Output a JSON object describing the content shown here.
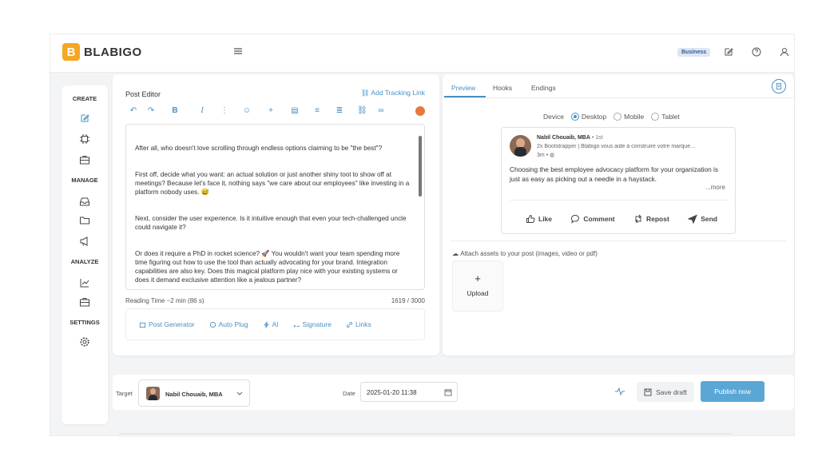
{
  "app": {
    "logo_letter": "B",
    "name": "BLABIGO",
    "plan_badge": "Business"
  },
  "sidebar": {
    "sections": [
      {
        "label": "CREATE",
        "icons": [
          "edit-icon",
          "chip-icon",
          "briefcase-icon"
        ]
      },
      {
        "label": "MANAGE",
        "icons": [
          "inbox-icon",
          "folder-icon",
          "megaphone-icon"
        ]
      },
      {
        "label": "ANALYZE",
        "icons": [
          "chart-icon",
          "briefcase-icon"
        ]
      },
      {
        "label": "SETTINGS",
        "icons": [
          "gear-icon"
        ]
      }
    ]
  },
  "editor": {
    "title": "Post Editor",
    "tracking_link": "Add Tracking Link",
    "paragraphs": [
      "After all, who doesn't love scrolling through endless options claiming to be \"the best\"?",
      "First off, decide what you want: an actual solution or just another shiny tool to show off at meetings? Because let's face it, nothing says \"we care about our employees\" like investing in a platform nobody uses. 😅",
      "Next, consider the user experience. Is it intuitive enough that even your tech-challenged uncle could navigate it?",
      "Or does it require a PhD in rocket science? 🚀 You wouldn't want your team spending more time figuring out how to use the tool than actually advocating for your brand. Integration capabilities are also key. Does this magical platform play nice with your existing systems or does it demand exclusive attention like a jealous partner?"
    ],
    "reading_time": "Reading Time ~2 min (86 s)",
    "char_count": "1619 / 3000",
    "tools": [
      "Post Generator",
      "Auto Plug",
      "AI",
      "Signature",
      "Links"
    ]
  },
  "preview": {
    "tabs": [
      "Preview",
      "Hooks",
      "Endings"
    ],
    "device_label": "Device",
    "devices": [
      "Desktop",
      "Mobile",
      "Tablet"
    ],
    "selected_device": "Desktop",
    "post": {
      "author": "Nabil Chouaib, MBA",
      "degree": "• 1st",
      "headline": "2x Bootstrapper | Blabigo vous aide à construire votre marque…",
      "time": "3m •",
      "body": "Choosing the best employee advocacy platform for your organization is just as easy as picking out a needle in a haystack.",
      "more": "...more",
      "actions": [
        "Like",
        "Comment",
        "Repost",
        "Send"
      ]
    },
    "attach_label": "Attach assets to your post (images, video or pdf)",
    "upload_label": "Upload"
  },
  "footer": {
    "target_label": "Target",
    "target_value": "Nabil Chouaib, MBA",
    "date_label": "Date",
    "date_value": "2025-01-20  11:38",
    "save_draft": "Save draft",
    "publish": "Publish now"
  },
  "colors": {
    "accent": "#4a90c2",
    "logo": "#f5a623",
    "publish": "#5aa7d6"
  }
}
